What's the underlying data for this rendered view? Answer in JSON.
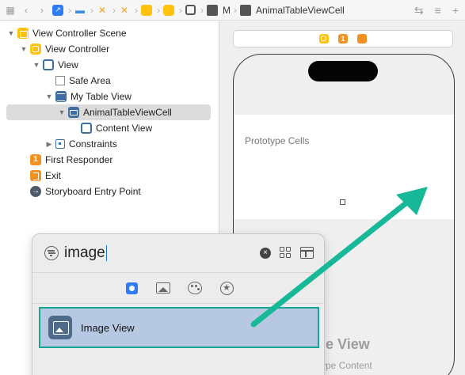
{
  "jumpbar": {
    "crumb_short": "M",
    "crumb_cell": "AnimalTableViewCell"
  },
  "outline": {
    "items": [
      {
        "label": "View Controller Scene"
      },
      {
        "label": "View Controller"
      },
      {
        "label": "View"
      },
      {
        "label": "Safe Area"
      },
      {
        "label": "My Table View"
      },
      {
        "label": "AnimalTableViewCell"
      },
      {
        "label": "Content View"
      },
      {
        "label": "Constraints"
      },
      {
        "label": "First Responder"
      },
      {
        "label": "Exit"
      },
      {
        "label": "Storyboard Entry Point"
      }
    ],
    "first_responder_glyph": "1"
  },
  "canvas": {
    "prototype_cells_label": "Prototype Cells",
    "ghost_title": "ble View",
    "ghost_subtitle": "otype Content",
    "dock_first_responder_glyph": "1"
  },
  "library": {
    "search_value": "image",
    "clear_glyph": "×",
    "snippet_glyph": "★",
    "result_label": "Image View",
    "accent_color": "#17a594",
    "selection_color": "#b7c8e3"
  },
  "annotation": {
    "arrow_color": "#17b898"
  }
}
